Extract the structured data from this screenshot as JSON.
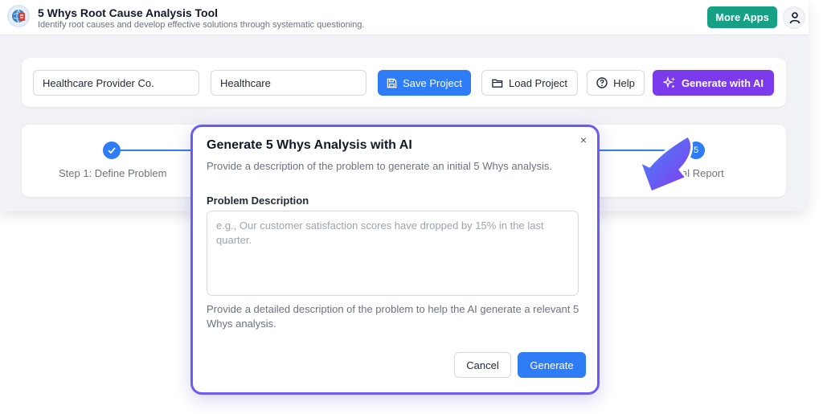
{
  "header": {
    "title": "5 Whys Root Cause Analysis Tool",
    "subtitle": "Identify root causes and develop effective solutions through systematic questioning.",
    "more_apps_label": "More Apps",
    "logo_icon": "globe-clipboard-icon",
    "user_icon": "user-icon"
  },
  "toolbar": {
    "company_value": "Healthcare Provider Co.",
    "industry_value": "Healthcare",
    "save_label": "Save Project",
    "load_label": "Load Project",
    "help_label": "Help",
    "ai_label": "Generate with AI"
  },
  "steps": {
    "step1_label": "Step 1: Define Problem",
    "step5_number": "5",
    "step5_label_visible": "al Report"
  },
  "modal": {
    "title": "Generate 5 Whys Analysis with AI",
    "description": "Provide a description of the problem to generate an initial 5 Whys analysis.",
    "field_label": "Problem Description",
    "placeholder": "e.g., Our customer satisfaction scores have dropped by 15% in the last quarter.",
    "helper": "Provide a detailed description of the problem to help the AI generate a relevant 5 Whys analysis.",
    "cancel_label": "Cancel",
    "generate_label": "Generate",
    "close_symbol": "×"
  },
  "colors": {
    "primary": "#2f7df6",
    "ai_purple": "#7c3aed",
    "more_apps_green": "#16a085",
    "modal_border": "#6a5cf4"
  }
}
